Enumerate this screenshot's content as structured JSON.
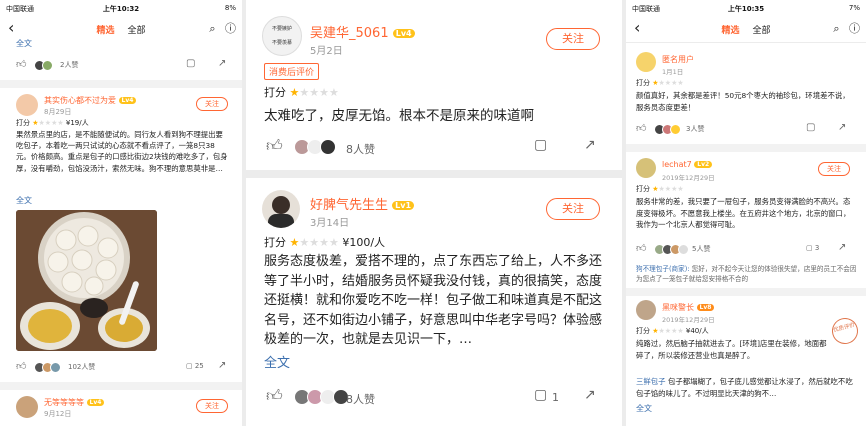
{
  "left": {
    "status": {
      "carrier": "中国联通",
      "time": "上午10:32",
      "battery": "8%"
    },
    "tabs": [
      "精选",
      "全部"
    ],
    "top_fragment": "全文",
    "top_likes": "2人赞",
    "review": {
      "user": "其实伤心都不过为爱",
      "level": "Lv4",
      "date": "8月29日",
      "score_label": "打分",
      "price": "¥19/人",
      "text": "果然景点里的店，是不能随便试的。同行友人看到狗不理提出要吃包子，本着吃一两只试试的心态就不看点评了，一笼8只38元。价格颇高。重点是包子的口感比街边2块钱的难吃多了，包身厚，没有嚼劲，包馅没汤汁，索然无味。狗不理的意思莫非是…",
      "more": "全文",
      "likes": "102人赞",
      "comments": "25"
    },
    "next_user": {
      "name": "无等等等等",
      "level": "Lv4",
      "date": "9月12日"
    },
    "follow_label": "关注"
  },
  "middle": {
    "card1": {
      "user": "吴建华_5061",
      "level": "Lv4",
      "date": "5月2日",
      "tag": "消费后评价",
      "score_label": "打分",
      "text": "太难吃了，皮厚无馅。根本不是原来的味道啊",
      "likes": "8人赞",
      "avatar_text_1": "不要嫉妒",
      "avatar_text_2": "不要羡慕"
    },
    "card2": {
      "user": "好脾气先生生",
      "level": "Lv1",
      "date": "3月14日",
      "score_label": "打分",
      "price": "¥100/人",
      "text": "服务态度极差，爱搭不理的，点了东西忘了给上，人不多还等了半小时，结婚服务员怀疑我没付钱，真的很搞笑，态度还挺横！就和你爱吃不吃一样！包子做工和味道真是不配这名号，还不如街边小铺子，好意思叫中华老字号吗？体验感极差的一次，也就是去见识一下，…",
      "more": "全文",
      "likes": "8人赞",
      "comments": "1"
    },
    "follow_label": "关注"
  },
  "right": {
    "status": {
      "carrier": "中国联通",
      "time": "上午10:35",
      "battery": "7%"
    },
    "tabs": [
      "精选",
      "全部"
    ],
    "r1": {
      "user": "匿名用户",
      "date": "1月1日",
      "score_label": "打分",
      "text": "颜值真好，其余都是差评！50元8个枣大的袖珍包，环境差不说，服务员态度更差！",
      "likes": "3人赞"
    },
    "r2": {
      "user": "lechat7",
      "level": "Lv2",
      "date": "2019年12月29日",
      "score_label": "打分",
      "text": "服务非常的差，我只要了一屉包子，服务员变得满脸的不高兴。态度变得极坏。不愿意我上楼坐。在五府井这个地方，北京的窗口，我作为一个北京人都觉得可耻。",
      "likes": "5人赞",
      "comments": "3",
      "merchant_name": "狗不理包子(商家):",
      "merchant_reply": "您好，对不起今天让您的体验很失望，店里的员工不会因为您点了一笼包子就给您安排格不合的"
    },
    "r3": {
      "user": "黑咪警长",
      "level": "Lv8",
      "date": "2019年12月29日",
      "score_label": "打分",
      "price": "¥40/人",
      "text": "纯路过，然后脑子抽就进去了。[环境]店里在装修，地面都碎了，所以装修还营业也真是醉了。",
      "text2": "包子都塌糊了，包子底儿感觉都让水浸了，然后就吃不吃包子馅的味儿了。不过明显比天津的狗不…",
      "tag": "三鲜包子",
      "more": "全文",
      "stamp": "优质评价"
    },
    "follow_label": "关注"
  },
  "icons": [
    "back-icon",
    "search-icon",
    "help-icon",
    "thumb-up-icon",
    "comment-icon",
    "share-icon",
    "star-icon"
  ],
  "colors": {
    "accent": "#ff6633",
    "level": "#ffc21a",
    "star": "#ffb300",
    "link": "#3c6fae"
  }
}
